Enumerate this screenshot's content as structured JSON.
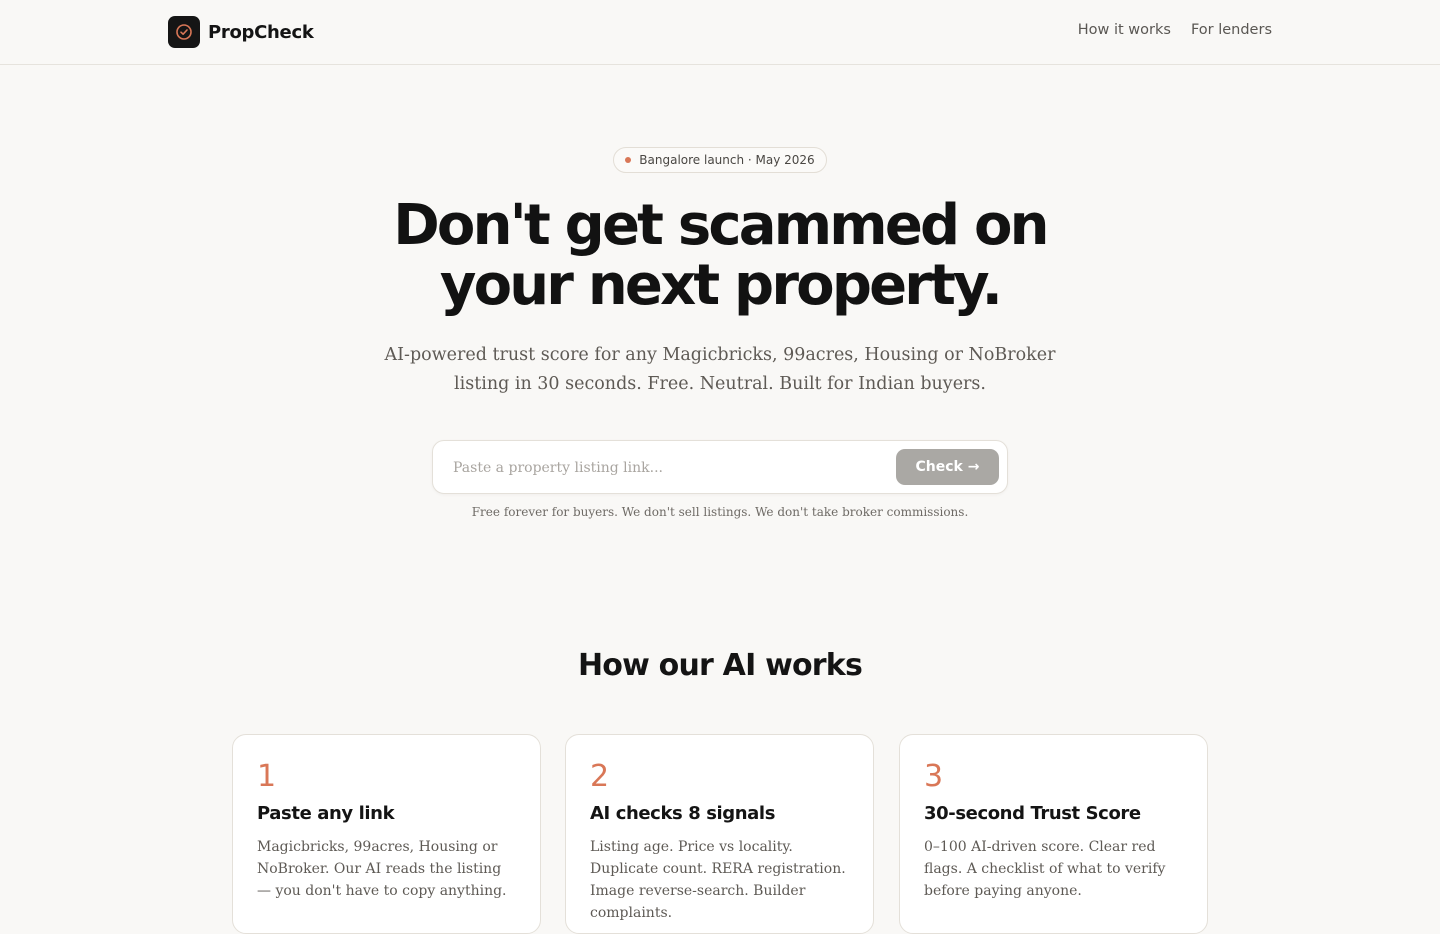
{
  "brand": {
    "name": "PropCheck",
    "logo_icon": "check-circle-icon",
    "accent_color": "#d97757"
  },
  "nav": {
    "links": [
      "How it works",
      "For lenders"
    ]
  },
  "hero": {
    "badge": "Bangalore launch · May 2026",
    "headline_line1": "Don't get scammed on",
    "headline_line2": "your next property.",
    "subhead": "AI-powered trust score for any Magicbricks, 99acres, Housing or NoBroker listing in 30 seconds. Free. Neutral. Built for Indian buyers.",
    "search_placeholder": "Paste a property listing link...",
    "search_value": "",
    "button_label": "Check →",
    "fine_print": "Free forever for buyers. We don't sell listings. We don't take broker commissions."
  },
  "how_it_works": {
    "title": "How our AI works",
    "steps": [
      {
        "number": "1",
        "title": "Paste any link",
        "body": "Magicbricks, 99acres, Housing or NoBroker. Our AI reads the listing — you don't have to copy anything."
      },
      {
        "number": "2",
        "title": "AI checks 8 signals",
        "body": "Listing age. Price vs locality. Duplicate count. RERA registration. Image reverse-search. Builder complaints."
      },
      {
        "number": "3",
        "title": "30-second Trust Score",
        "body": "0–100 AI-driven score. Clear red flags. A checklist of what to verify before paying anyone."
      }
    ]
  }
}
